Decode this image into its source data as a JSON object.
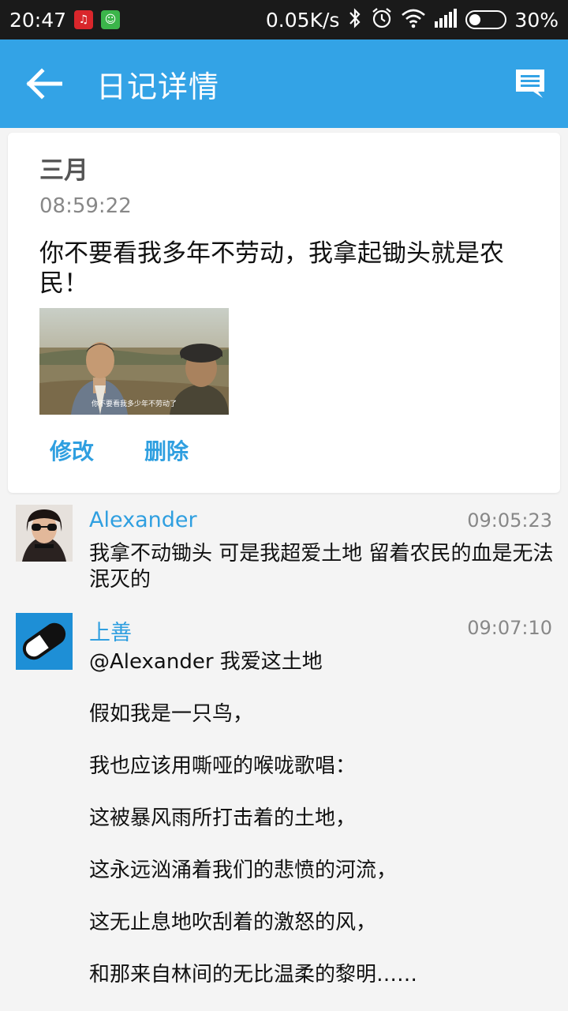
{
  "status_bar": {
    "time": "20:47",
    "net_speed": "0.05K/s",
    "battery": "30%",
    "battery_level": 0.3,
    "icons": [
      "netease-music-icon",
      "app-green-icon",
      "bluetooth-icon",
      "alarm-icon",
      "wifi-icon",
      "signal-icon",
      "battery-icon"
    ]
  },
  "app_bar": {
    "title": "日记详情",
    "back_icon": "back-arrow-icon",
    "comment_icon": "comment-icon",
    "color": "#33a3e6"
  },
  "diary": {
    "month": "三月",
    "time": "08:59:22",
    "content": "你不要看我多年不劳动，我拿起锄头就是农民！",
    "photo_caption": "你不要看我多少年不劳动了",
    "actions": {
      "edit": "修改",
      "delete": "删除"
    }
  },
  "comments": [
    {
      "name": "Alexander",
      "time": "09:05:23",
      "text": "我拿不动锄头 可是我超爱土地 留着农民的血是无法泯灭的"
    },
    {
      "name": "上善",
      "time": "09:07:10",
      "lines": [
        "@Alexander 我爱这土地",
        "假如我是一只鸟，",
        "我也应该用嘶哑的喉咙歌唱：",
        "这被暴风雨所打击着的土地，",
        "这永远汹涌着我们的悲愤的河流，",
        "这无止息地吹刮着的激怒的风，",
        "和那来自林间的无比温柔的黎明……"
      ]
    }
  ]
}
